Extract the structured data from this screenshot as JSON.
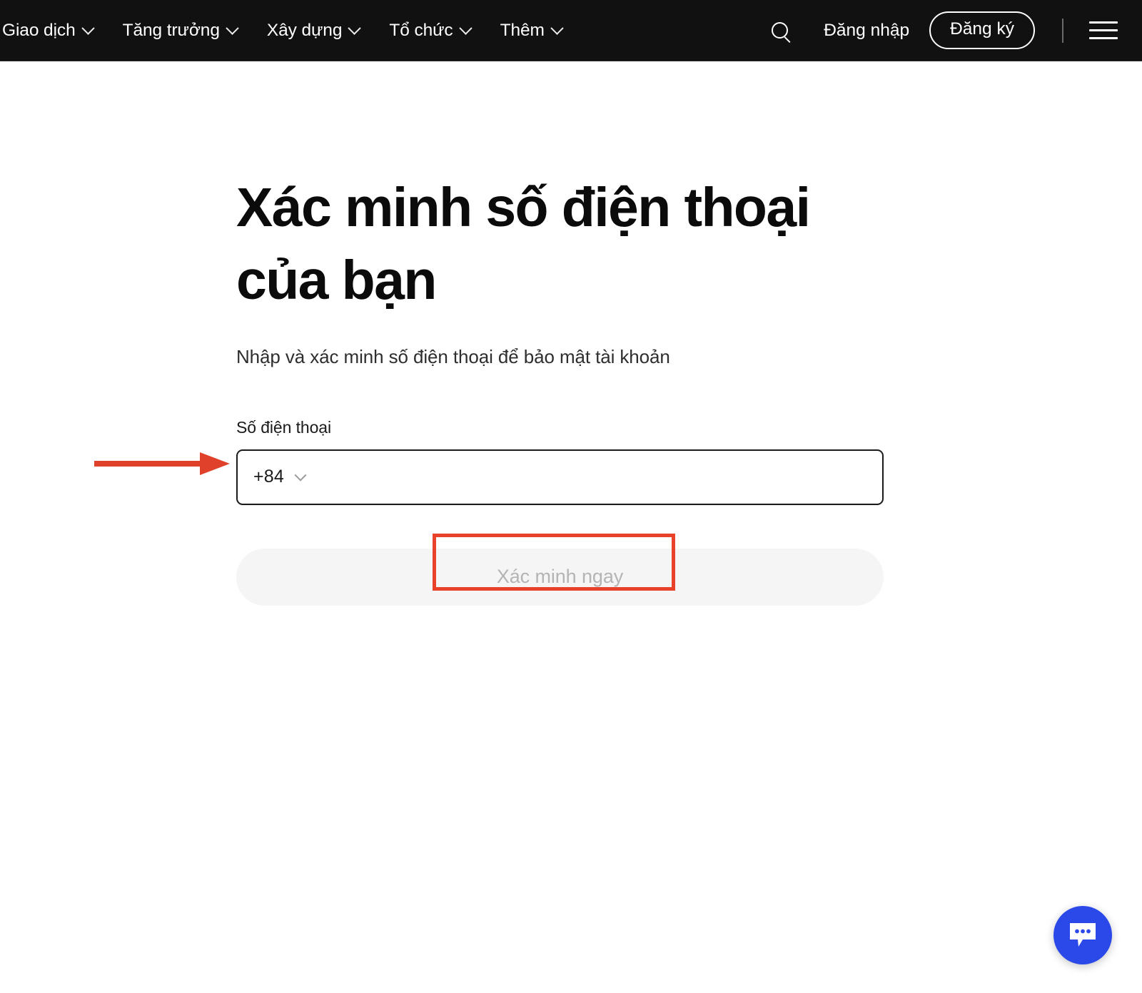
{
  "header": {
    "nav_items": [
      {
        "label": "Giao dịch",
        "has_caret": true
      },
      {
        "label": "Tăng trưởng",
        "has_caret": true
      },
      {
        "label": "Xây dựng",
        "has_caret": true
      },
      {
        "label": "Tổ chức",
        "has_caret": true
      },
      {
        "label": "Thêm",
        "has_caret": true
      }
    ],
    "search_icon": "search-icon",
    "login_label": "Đăng nhập",
    "signup_label": "Đăng ký",
    "menu_icon": "hamburger-menu-icon",
    "background_color": "#111111",
    "text_color": "#ffffff"
  },
  "main": {
    "title": "Xác minh số điện thoại của bạn",
    "subtitle": "Nhập và xác minh số điện thoại để bảo mật tài khoản",
    "form": {
      "phone_label": "Số điện thoại",
      "country_code": "+84",
      "country_code_chevron": "chevron-down-icon",
      "phone_value": "",
      "phone_placeholder": "",
      "submit_label": "Xác minh ngay",
      "submit_disabled": true,
      "submit_bg_color": "#f5f5f5",
      "submit_text_color": "#b4b4b4"
    }
  },
  "annotations": {
    "color": "#e8432a",
    "arrow": {
      "name": "red-arrow-pointing-to-phone-input",
      "points_to": "phone-input-field"
    },
    "rectangle": {
      "name": "red-highlight-box-around-submit-label",
      "highlights": "submit-button-label"
    }
  },
  "chat_widget": {
    "icon": "chat-bubble-icon",
    "background_color": "#2b49e8",
    "dot_count": 3
  }
}
